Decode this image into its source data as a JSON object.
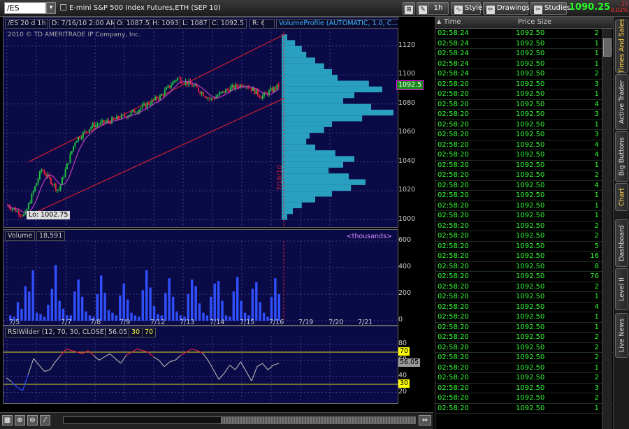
{
  "toolbar": {
    "symbol": "/ES",
    "title": "E-mini S&P 500 Index Futures,ETH (SEP 10)",
    "timeframe": "1h",
    "style_label": "Style",
    "drawings_label": "Drawings",
    "studies_label": "Studies",
    "last_price": "1090.25",
    "net_change": "-.25",
    "pct_change": "-0.02%"
  },
  "price_pane": {
    "header": {
      "symbol": "/ES 20 d 1h",
      "date": "D: 7/16/10 2:00 AM",
      "open": "O: 1087.5",
      "high": "H: 1093",
      "low": "L: 1087",
      "close": "C: 1092.5",
      "range": "R: 6",
      "study": "VolumeProfile (AUTOMATIC, 1.0, C..."
    },
    "copyright": "2010 © TD AMERITRADE IP Company, Inc.",
    "low_label": "Lo: 1002.75",
    "date_marker": "7/16/10",
    "current_price_tag": "1092.5",
    "y_ticks": [
      "1120",
      "1100",
      "1080",
      "1060",
      "1040",
      "1020",
      "1000"
    ]
  },
  "volume_pane": {
    "label": "Volume",
    "value": "18,591",
    "units": "<thousands>",
    "y_ticks": [
      "600",
      "400",
      "200",
      "0"
    ],
    "x_ticks": [
      "7/5",
      "7/7",
      "7/8",
      "7/9",
      "7/12",
      "7/13",
      "7/14",
      "7/15",
      "7/16",
      "7/19",
      "7/20",
      "7/21"
    ]
  },
  "rsi_pane": {
    "label": "RSIWilder (12, 70, 30, CLOSE)",
    "value": "56.05",
    "ob": "30",
    "os": "70",
    "y_ticks": [
      "80",
      "60",
      "40",
      "20"
    ],
    "tag_70": "70",
    "tag_30": "30",
    "tag_value": "56.05"
  },
  "chart_data": [
    {
      "type": "line",
      "title": "/ES 20 d 1h",
      "ylim": [
        995,
        1130
      ],
      "x": [
        "7/5",
        "7/7",
        "7/8",
        "7/9",
        "7/12",
        "7/13",
        "7/14",
        "7/15",
        "7/16"
      ],
      "series": [
        {
          "values": [
            1010,
            1002.75,
            1035,
            1020,
            1055,
            1065,
            1068,
            1072,
            1078,
            1085,
            1098,
            1092,
            1083,
            1090,
            1094,
            1085,
            1092.5
          ]
        }
      ],
      "volume_profile": {
        "prices": [
          1126,
          1122,
          1118,
          1114,
          1110,
          1106,
          1102,
          1098,
          1094,
          1090,
          1086,
          1082,
          1078,
          1074,
          1070,
          1066,
          1062,
          1058,
          1054,
          1050,
          1046,
          1042,
          1038,
          1034,
          1030,
          1026,
          1022,
          1018,
          1014,
          1010,
          1006,
          1002
        ],
        "values": [
          0.05,
          0.12,
          0.18,
          0.22,
          0.3,
          0.38,
          0.45,
          0.5,
          0.78,
          0.9,
          0.65,
          0.55,
          0.8,
          1.0,
          0.72,
          0.45,
          0.38,
          0.25,
          0.22,
          0.3,
          0.48,
          0.65,
          0.55,
          0.42,
          0.6,
          0.75,
          0.62,
          0.45,
          0.3,
          0.18,
          0.1,
          0.05
        ]
      }
    },
    {
      "type": "bar",
      "title": "Volume",
      "ylim": [
        0,
        600
      ],
      "values": [
        40,
        30,
        140,
        90,
        260,
        220,
        380,
        60,
        50,
        30,
        120,
        240,
        420,
        150,
        90,
        40,
        40,
        220,
        310,
        180,
        70,
        40,
        30,
        200,
        340,
        210,
        80,
        60,
        40,
        190,
        280,
        160,
        60,
        40,
        30,
        230,
        380,
        250,
        110,
        50,
        40,
        210,
        320,
        180,
        70,
        40,
        30,
        200,
        310,
        260,
        130,
        60,
        40,
        180,
        280,
        300,
        150,
        40,
        30,
        220,
        330,
        150,
        60,
        40,
        240,
        290,
        140,
        60,
        30,
        180,
        320,
        200
      ]
    },
    {
      "type": "line",
      "title": "RSIWilder (12, 70, 30, CLOSE)",
      "ylim": [
        10,
        90
      ],
      "series": [
        {
          "values": [
            38,
            33,
            26,
            22,
            42,
            62,
            54,
            46,
            48,
            58,
            66,
            74,
            72,
            70,
            68,
            72,
            66,
            60,
            64,
            68,
            62,
            56,
            66,
            70,
            74,
            72,
            70,
            64,
            60,
            52,
            58,
            60,
            66,
            70,
            74,
            72,
            69,
            60,
            48,
            36,
            44,
            54,
            48,
            58,
            46,
            34,
            52,
            56,
            48,
            54,
            56
          ]
        }
      ]
    }
  ],
  "time_and_sales": {
    "columns": {
      "time": "Time",
      "price_size": "Price Size"
    },
    "rows": [
      {
        "time": "02:58:24",
        "price": "1092.50",
        "size": "2"
      },
      {
        "time": "02:58:24",
        "price": "1092.50",
        "size": "1"
      },
      {
        "time": "02:58:24",
        "price": "1092.50",
        "size": "1"
      },
      {
        "time": "02:58:24",
        "price": "1092.50",
        "size": "1"
      },
      {
        "time": "02:58:24",
        "price": "1092.50",
        "size": "2"
      },
      {
        "time": "02:58:20",
        "price": "1092.50",
        "size": "3"
      },
      {
        "time": "02:58:20",
        "price": "1092.50",
        "size": "1"
      },
      {
        "time": "02:58:20",
        "price": "1092.50",
        "size": "4"
      },
      {
        "time": "02:58:20",
        "price": "1092.50",
        "size": "3"
      },
      {
        "time": "02:58:20",
        "price": "1092.50",
        "size": "1"
      },
      {
        "time": "02:58:20",
        "price": "1092.50",
        "size": "3"
      },
      {
        "time": "02:58:20",
        "price": "1092.50",
        "size": "4"
      },
      {
        "time": "02:58:20",
        "price": "1092.50",
        "size": "4"
      },
      {
        "time": "02:58:20",
        "price": "1092.50",
        "size": "1"
      },
      {
        "time": "02:58:20",
        "price": "1092.50",
        "size": "2"
      },
      {
        "time": "02:58:20",
        "price": "1092.50",
        "size": "4"
      },
      {
        "time": "02:58:20",
        "price": "1092.50",
        "size": "1"
      },
      {
        "time": "02:58:20",
        "price": "1092.50",
        "size": "1"
      },
      {
        "time": "02:58:20",
        "price": "1092.50",
        "size": "1"
      },
      {
        "time": "02:58:20",
        "price": "1092.50",
        "size": "2"
      },
      {
        "time": "02:58:20",
        "price": "1092.50",
        "size": "2"
      },
      {
        "time": "02:58:20",
        "price": "1092.50",
        "size": "5"
      },
      {
        "time": "02:58:20",
        "price": "1092.50",
        "size": "16"
      },
      {
        "time": "02:58:20",
        "price": "1092.50",
        "size": "8"
      },
      {
        "time": "02:58:20",
        "price": "1092.50",
        "size": "76"
      },
      {
        "time": "02:58:20",
        "price": "1092.50",
        "size": "2"
      },
      {
        "time": "02:58:20",
        "price": "1092.50",
        "size": "1"
      },
      {
        "time": "02:58:20",
        "price": "1092.50",
        "size": "4"
      },
      {
        "time": "02:58:20",
        "price": "1092.50",
        "size": "1"
      },
      {
        "time": "02:58:20",
        "price": "1092.50",
        "size": "1"
      },
      {
        "time": "02:58:20",
        "price": "1092.50",
        "size": "2"
      },
      {
        "time": "02:58:20",
        "price": "1092.50",
        "size": "2"
      },
      {
        "time": "02:58:20",
        "price": "1092.50",
        "size": "2"
      },
      {
        "time": "02:58:20",
        "price": "1092.50",
        "size": "1"
      },
      {
        "time": "02:58:20",
        "price": "1092.50",
        "size": "2"
      },
      {
        "time": "02:58:20",
        "price": "1092.50",
        "size": "3"
      },
      {
        "time": "02:58:20",
        "price": "1092.50",
        "size": "2"
      },
      {
        "time": "02:58:20",
        "price": "1092.50",
        "size": "1"
      }
    ]
  },
  "side_tabs": [
    "Times And Sales",
    "Active Trader",
    "Big Buttons",
    "Chart",
    "Dashboard",
    "Level II",
    "Live News"
  ],
  "colors": {
    "pane_bg": "#0a0a46",
    "grid": "#3c3c8c",
    "up": "#20c040",
    "down": "#e02040",
    "channel": "#d02030",
    "profile": "#2aa0c0",
    "volume": "#3050ff",
    "rsi_line": "#aaaaaa",
    "rsi_level": "#d8d820",
    "ts_text": "#30ff30"
  }
}
